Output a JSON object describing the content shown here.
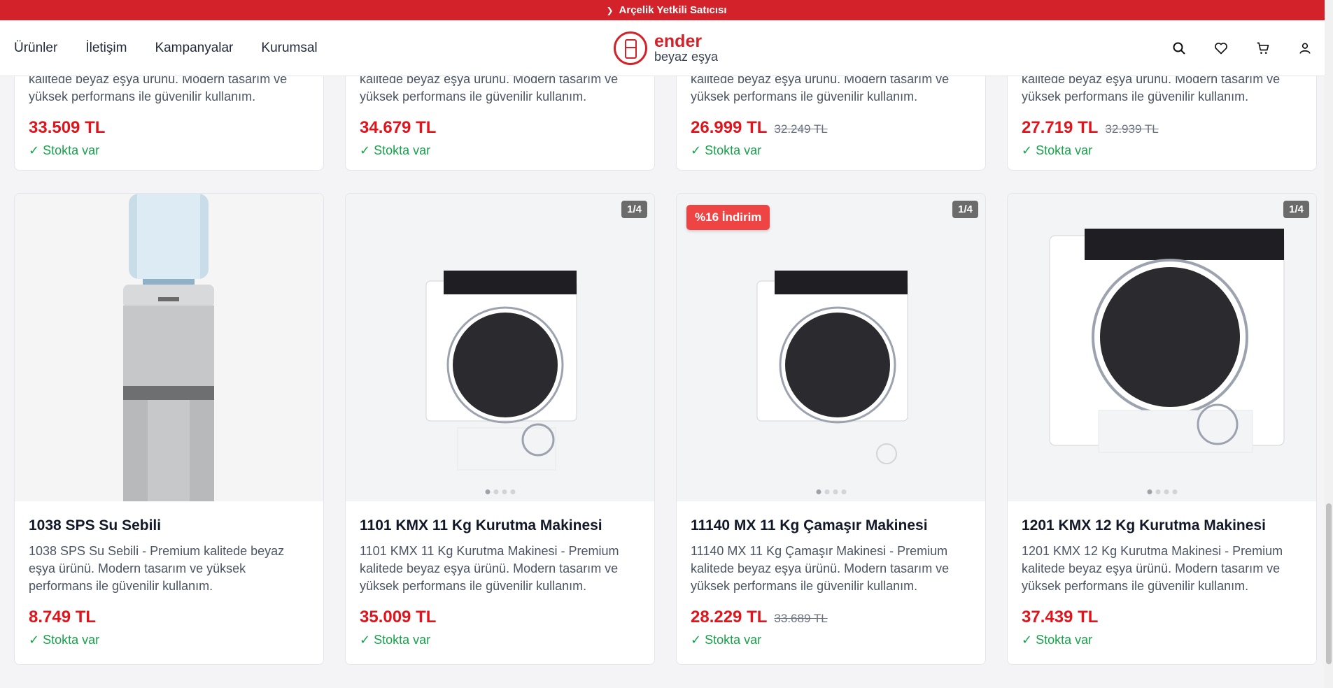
{
  "banner": {
    "text": "Arçelik Yetkili Satıcısı"
  },
  "nav": [
    "Ürünler",
    "İletişim",
    "Kampanyalar",
    "Kurumsal"
  ],
  "logo": {
    "line1": "ender",
    "line2": "beyaz eşya"
  },
  "top_cards": [
    {
      "desc": "kalitede beyaz eşya ürünü. Modern tasarım ve yüksek performans ile güvenilir kullanım.",
      "price": "33.509 TL",
      "old_price": "",
      "stock": "✓ Stokta var"
    },
    {
      "desc": "kalitede beyaz eşya ürünü. Modern tasarım ve yüksek performans ile güvenilir kullanım.",
      "price": "34.679 TL",
      "old_price": "",
      "stock": "✓ Stokta var"
    },
    {
      "desc": "kalitede beyaz eşya ürünü. Modern tasarım ve yüksek performans ile güvenilir kullanım.",
      "price": "26.999 TL",
      "old_price": "32.249 TL",
      "stock": "✓ Stokta var"
    },
    {
      "desc": "kalitede beyaz eşya ürünü. Modern tasarım ve yüksek performans ile güvenilir kullanım.",
      "price": "27.719 TL",
      "old_price": "32.939 TL",
      "stock": "✓ Stokta var"
    }
  ],
  "products": [
    {
      "title": "1038 SPS Su Sebili",
      "desc": "1038 SPS Su Sebili - Premium kalitede beyaz eşya ürünü. Modern tasarım ve yüksek performans ile güvenilir kullanım.",
      "price": "8.749 TL",
      "old_price": "",
      "stock": "✓ Stokta var",
      "pager": "",
      "badge": "",
      "image": "water-dispenser"
    },
    {
      "title": "1101 KMX 11 Kg Kurutma Makinesi",
      "desc": "1101 KMX 11 Kg Kurutma Makinesi - Premium kalitede beyaz eşya ürünü. Modern tasarım ve yüksek performans ile güvenilir kullanım.",
      "price": "35.009 TL",
      "old_price": "",
      "stock": "✓ Stokta var",
      "pager": "1/4",
      "badge": "",
      "image": "dryer"
    },
    {
      "title": "11140 MX 11 Kg Çamaşır Makinesi",
      "desc": "11140 MX 11 Kg Çamaşır Makinesi - Premium kalitede beyaz eşya ürünü. Modern tasarım ve yüksek performans ile güvenilir kullanım.",
      "price": "28.229 TL",
      "old_price": "33.689 TL",
      "stock": "✓ Stokta var",
      "pager": "1/4",
      "badge": "%16 İndirim",
      "image": "washer"
    },
    {
      "title": "1201 KMX 12 Kg Kurutma Makinesi",
      "desc": "1201 KMX 12 Kg Kurutma Makinesi - Premium kalitede beyaz eşya ürünü. Modern tasarım ve yüksek performans ile güvenilir kullanım.",
      "price": "37.439 TL",
      "old_price": "",
      "stock": "✓ Stokta var",
      "pager": "1/4",
      "badge": "",
      "image": "dryer-large"
    }
  ]
}
